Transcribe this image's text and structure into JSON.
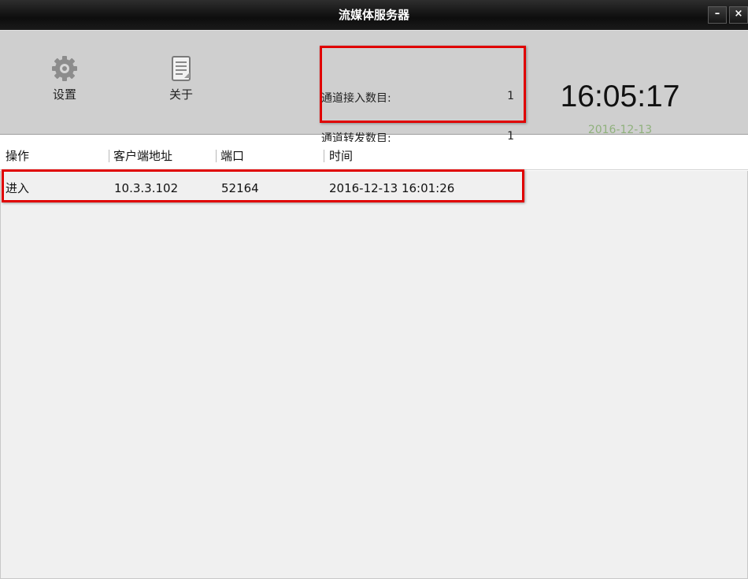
{
  "window": {
    "title": "流媒体服务器",
    "minimize_glyph": "–",
    "close_glyph": "×"
  },
  "toolbar": {
    "settings_label": "设置",
    "settings_icon": "gear-icon",
    "about_label": "关于",
    "about_icon": "document-icon"
  },
  "stats": {
    "access_label": "通道接入数目:",
    "access_value": "1",
    "forward_label": "通道转发数目:",
    "forward_value": "1"
  },
  "clock": {
    "time": "16:05:17",
    "date": "2016-12-13"
  },
  "table": {
    "columns": [
      "操作",
      "客户端地址",
      "端口",
      "时间"
    ],
    "rows": [
      {
        "action": "进入",
        "address": "10.3.3.102",
        "port": "52164",
        "time": "2016-12-13 16:01:26"
      }
    ]
  },
  "colors": {
    "highlight": "#e00000",
    "toolbar_bg": "#cfcfcf",
    "date_green": "#8fb17c"
  }
}
